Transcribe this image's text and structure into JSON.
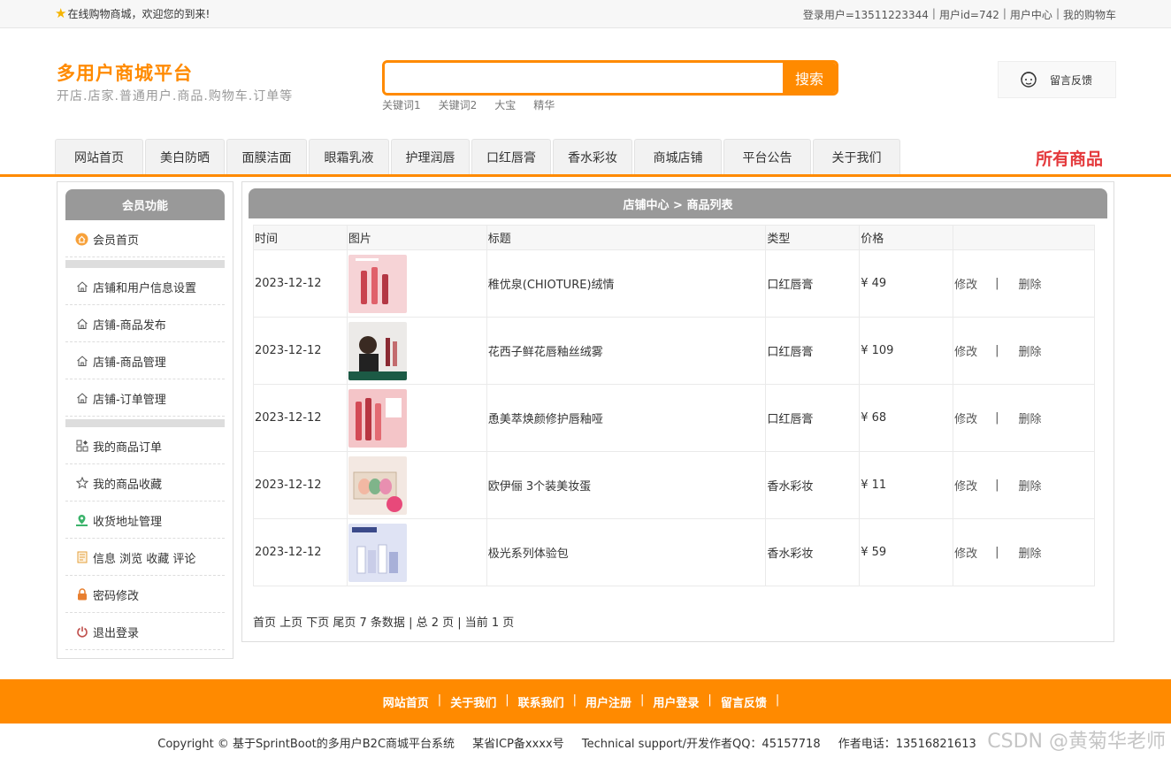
{
  "topbar": {
    "welcome": "在线购物商城，欢迎您的到来!",
    "login_user": "登录用户=13511223344",
    "user_id": "用户id=742",
    "user_center": "用户中心",
    "my_cart": "我的购物车",
    "separator": "|"
  },
  "header": {
    "title": "多用户商城平台",
    "subtitle": "开店.店家.普通用户.商品.购物车.订单等",
    "search_placeholder": "",
    "search_button": "搜索",
    "hotwords": [
      "关键词1",
      "关键词2",
      "大宝",
      "精华"
    ],
    "feedback": "留言反馈"
  },
  "nav": {
    "tabs": [
      "网站首页",
      "美白防晒",
      "面膜洁面",
      "眼霜乳液",
      "护理润唇",
      "口红唇膏",
      "香水彩妆",
      "商城店铺",
      "平台公告",
      "关于我们"
    ],
    "all_goods": "所有商品"
  },
  "sidebar": {
    "title": "会员功能",
    "home": "会员首页",
    "group1": [
      "店铺和用户信息设置",
      "店铺-商品发布",
      "店铺-商品管理",
      "店铺-订单管理"
    ],
    "group2": [
      "我的商品订单",
      "我的商品收藏",
      "收货地址管理",
      "信息 浏览 收藏 评论",
      "密码修改",
      "退出登录"
    ]
  },
  "main": {
    "title": "店铺中心 > 商品列表",
    "columns": [
      "时间",
      "图片",
      "标题",
      "类型",
      "价格",
      ""
    ],
    "edit_label": "修改",
    "delete_label": "删除",
    "action_sep": "|",
    "rows": [
      {
        "date": "2023-12-12",
        "title": "稚优泉(CHIOTURE)绒情",
        "type": "口红唇膏",
        "price": "¥ 49"
      },
      {
        "date": "2023-12-12",
        "title": "花西子鲜花唇釉丝绒雾",
        "type": "口红唇膏",
        "price": "¥ 109"
      },
      {
        "date": "2023-12-12",
        "title": "恿美萃焕颜修护唇釉哑",
        "type": "口红唇膏",
        "price": "¥ 68"
      },
      {
        "date": "2023-12-12",
        "title": "欧伊俪 3个装美妆蛋",
        "type": "香水彩妆",
        "price": "¥ 11"
      },
      {
        "date": "2023-12-12",
        "title": "极光系列体验包",
        "type": "香水彩妆",
        "price": "¥ 59"
      }
    ],
    "pager": "首页 上页 下页 尾页 7 条数据 | 总 2 页 | 当前 1 页"
  },
  "footer": {
    "links": [
      "网站首页",
      "关于我们",
      "联系我们",
      "用户注册",
      "用户登录",
      "留言反馈"
    ],
    "separator": "|",
    "copyright": "Copyright © 基于SprintBoot的多用户B2C商城平台系统",
    "icp": "某省ICP备xxxx号",
    "support": "Technical support/开发作者QQ：45157718",
    "phone": "作者电话：13516821613"
  },
  "watermark": "CSDN @黄菊华老师",
  "colors": {
    "accent": "#ff8a00",
    "header_gray": "#999999",
    "all_goods_red": "#e4393c"
  }
}
